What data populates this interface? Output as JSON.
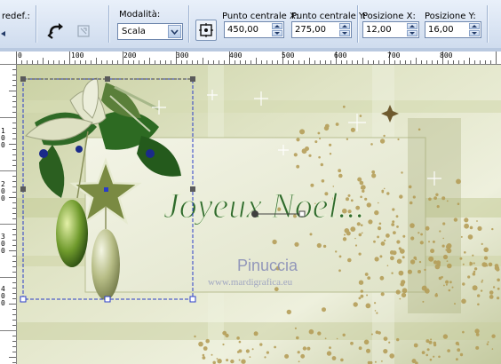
{
  "toolbar": {
    "preset_label": "redef.:",
    "mode_label": "Modalità:",
    "mode_value": "Scala",
    "center_x_label": "Punto centrale X:",
    "center_x_value": "450,00",
    "center_y_label": "Punto centrale Y:",
    "center_y_value": "275,00",
    "pos_x_label": "Posizione X:",
    "pos_x_value": "12,00",
    "pos_y_label": "Posizione Y:",
    "pos_y_value": "16,00"
  },
  "ruler": {
    "top_labels": [
      "0",
      "100",
      "200",
      "300",
      "400",
      "500",
      "600",
      "700",
      "800"
    ],
    "left_labels": [
      "1 0 0",
      "2 0 0",
      "3 0 0",
      "4 0 0"
    ]
  },
  "canvas": {
    "title_text": "Joyeux Noel...",
    "watermark_name": "Pinuccia",
    "watermark_url": "www.mardigrafica.eu"
  },
  "colors": {
    "toolbar_bg": "#dfe8f5",
    "selection": "#2a3cc8",
    "title_green": "#2f6a2c",
    "card_bg": "#eef0dc"
  },
  "icons": {
    "undo": "curved-arrow-icon",
    "disabled_pick": "pick-tool-icon",
    "center": "center-point-icon"
  }
}
